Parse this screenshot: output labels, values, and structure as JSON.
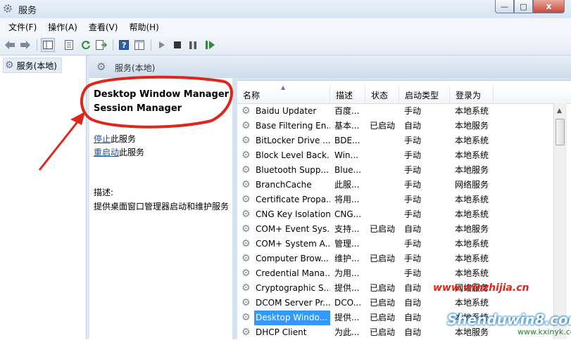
{
  "window": {
    "title": "服务",
    "close": "x",
    "minimize": "—",
    "maximize": "□"
  },
  "menu": [
    {
      "label": "文件(F)"
    },
    {
      "label": "操作(A)"
    },
    {
      "label": "查看(V)"
    },
    {
      "label": "帮助(H)"
    }
  ],
  "toolbar": {
    "icons": [
      "back-icon",
      "forward-icon",
      "console-tree-icon",
      "properties-icon",
      "refresh-icon",
      "export-icon",
      "help-icon",
      "view-icon",
      "play-icon",
      "stop-icon",
      "pause-icon",
      "resume-icon"
    ]
  },
  "tree": {
    "item": "服务(本地)"
  },
  "header": {
    "title": "服务(本地)"
  },
  "details": {
    "service_name": "Desktop Window Manager Session Manager",
    "stop_link": "停止",
    "stop_suffix": "此服务",
    "restart_link": "重启动",
    "restart_suffix": "此服务",
    "description_label": "描述:",
    "description_text": "提供桌面窗口管理器启动和维护服务"
  },
  "table": {
    "columns": [
      "名称",
      "描述",
      "状态",
      "启动类型",
      "登录为"
    ],
    "rows": [
      {
        "name": "Baidu Updater",
        "desc": "百度...",
        "status": "",
        "startup": "手动",
        "logon": "本地系统"
      },
      {
        "name": "Base Filtering En...",
        "desc": "基本...",
        "status": "已启动",
        "startup": "自动",
        "logon": "本地服务"
      },
      {
        "name": "BitLocker Drive ...",
        "desc": "BDE...",
        "status": "",
        "startup": "手动",
        "logon": "本地系统"
      },
      {
        "name": "Block Level Back...",
        "desc": "Win...",
        "status": "",
        "startup": "手动",
        "logon": "本地系统"
      },
      {
        "name": "Bluetooth Supp...",
        "desc": "Blue...",
        "status": "",
        "startup": "手动",
        "logon": "本地服务"
      },
      {
        "name": "BranchCache",
        "desc": "此服...",
        "status": "",
        "startup": "手动",
        "logon": "网络服务"
      },
      {
        "name": "Certificate Propa...",
        "desc": "将用...",
        "status": "",
        "startup": "手动",
        "logon": "本地系统"
      },
      {
        "name": "CNG Key Isolation",
        "desc": "CNG...",
        "status": "",
        "startup": "手动",
        "logon": "本地系统"
      },
      {
        "name": "COM+ Event Sys...",
        "desc": "支持...",
        "status": "已启动",
        "startup": "自动",
        "logon": "本地服务"
      },
      {
        "name": "COM+ System A...",
        "desc": "管理...",
        "status": "",
        "startup": "手动",
        "logon": "本地系统"
      },
      {
        "name": "Computer Brow...",
        "desc": "维护...",
        "status": "已启动",
        "startup": "手动",
        "logon": "本地系统"
      },
      {
        "name": "Credential Mana...",
        "desc": "为用...",
        "status": "",
        "startup": "手动",
        "logon": "本地系统"
      },
      {
        "name": "Cryptographic S...",
        "desc": "提供...",
        "status": "已启动",
        "startup": "自动",
        "logon": "网络服务"
      },
      {
        "name": "DCOM Server Pr...",
        "desc": "DCO...",
        "status": "已启动",
        "startup": "自动",
        "logon": "本地系统"
      },
      {
        "name": "Desktop Windo...",
        "desc": "提供...",
        "status": "已启动",
        "startup": "自动",
        "logon": "本地系统",
        "selected": true
      },
      {
        "name": "DHCP Client",
        "desc": "为此...",
        "status": "已启动",
        "startup": "自动",
        "logon": "本地服务"
      }
    ]
  },
  "watermark": {
    "line1": "www.winzhijia.cn",
    "line2": "Shenduwin8.com",
    "line3": "www.kxinyk.com"
  },
  "colors": {
    "selection": "#3399ff",
    "annotation": "#e0261b",
    "link": "#1a4fa0"
  }
}
